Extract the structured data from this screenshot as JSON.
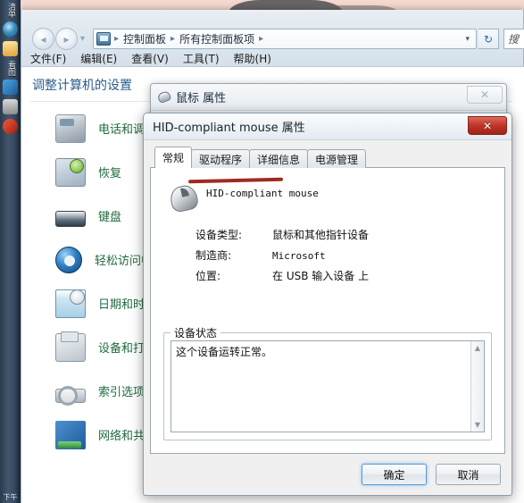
{
  "taskbar": {
    "labels": [
      "清单",
      "看图"
    ],
    "icons": [
      "internet-explorer-icon",
      "folder-icon",
      "windows-icon",
      "media-player-icon",
      "generic-app-icon"
    ],
    "clock": "下午"
  },
  "explorer": {
    "nav": {
      "back_label": "◂",
      "forward_label": "▸",
      "recent_label": "▾",
      "refresh_label": "↻",
      "address_dropdown": "▾"
    },
    "address": {
      "icon": "control-panel-icon",
      "crumbs": [
        "控制面板",
        "所有控制面板项"
      ],
      "separator": "▸"
    },
    "search": {
      "value": "搜",
      "placeholder": "搜索控制面板"
    },
    "menus": [
      "文件(F)",
      "编辑(E)",
      "查看(V)",
      "工具(T)",
      "帮助(H)"
    ],
    "heading": "调整计算机的设置",
    "items": [
      {
        "label": "电话和调制解调器",
        "icon": "phone-modem-icon"
      },
      {
        "label": "恢复",
        "icon": "recovery-icon"
      },
      {
        "label": "键盘",
        "icon": "keyboard-icon"
      },
      {
        "label": "轻松访问中心",
        "icon": "ease-of-access-icon"
      },
      {
        "label": "日期和时间",
        "icon": "date-time-icon"
      },
      {
        "label": "设备和打印机",
        "icon": "devices-printers-icon"
      },
      {
        "label": "索引选项",
        "icon": "indexing-options-icon"
      },
      {
        "label": "网络和共享中心",
        "icon": "network-sharing-icon"
      }
    ]
  },
  "mouse_dialog": {
    "title": "鼠标 属性",
    "icon": "mouse-icon",
    "close_label": "✕"
  },
  "hid_dialog": {
    "title": "HID-compliant mouse 属性",
    "close_label": "✕",
    "tabs": [
      {
        "label": "常规",
        "active": true
      },
      {
        "label": "驱动程序",
        "active": false
      },
      {
        "label": "详细信息",
        "active": false
      },
      {
        "label": "电源管理",
        "active": false
      }
    ],
    "device": {
      "icon": "mouse-device-icon",
      "name": "HID-compliant mouse",
      "annotation_color": "#9e2b22",
      "fields": [
        {
          "label": "设备类型:",
          "value": "鼠标和其他指针设备",
          "mono": false
        },
        {
          "label": "制造商:",
          "value": "Microsoft",
          "mono": true
        },
        {
          "label": "位置:",
          "value": "在 USB 输入设备 上",
          "mono": false
        }
      ]
    },
    "status": {
      "legend": "设备状态",
      "text": "这个设备运转正常。",
      "scroll_up": "▲",
      "scroll_down": "▼"
    },
    "buttons": {
      "ok": "确定",
      "cancel": "取消"
    }
  }
}
